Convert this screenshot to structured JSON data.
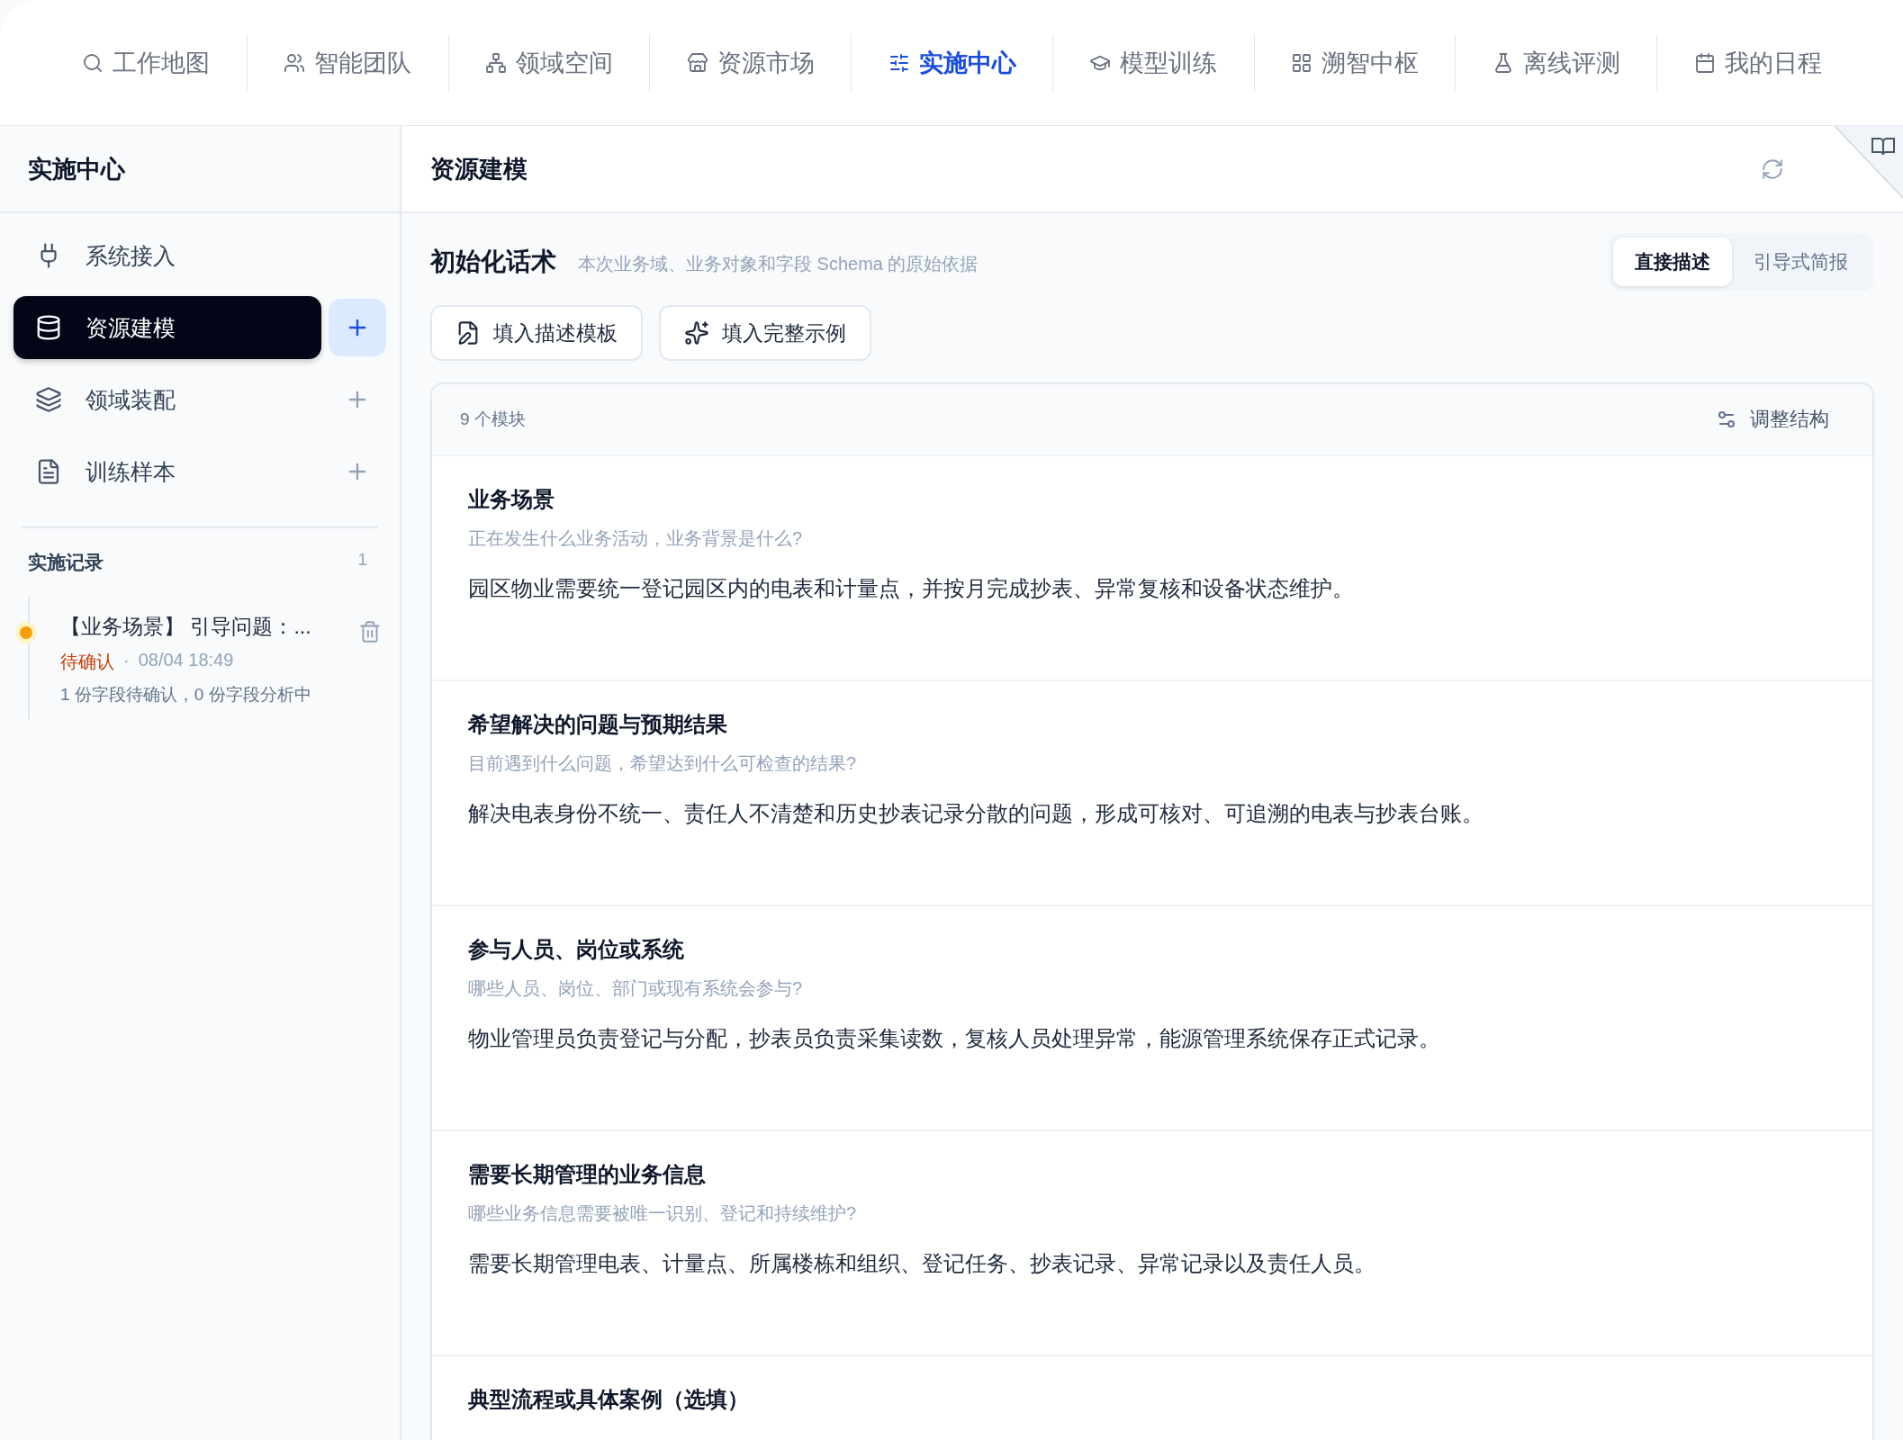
{
  "top_nav": [
    {
      "label": "工作地图",
      "selected": false
    },
    {
      "label": "智能团队",
      "selected": false
    },
    {
      "label": "领域空间",
      "selected": false
    },
    {
      "label": "资源市场",
      "selected": false
    },
    {
      "label": "实施中心",
      "selected": true
    },
    {
      "label": "模型训练",
      "selected": false
    },
    {
      "label": "溯智中枢",
      "selected": false
    },
    {
      "label": "离线评测",
      "selected": false
    },
    {
      "label": "我的日程",
      "selected": false
    }
  ],
  "sidebar": {
    "title": "实施中心",
    "items": [
      {
        "label": "系统接入",
        "selected": false,
        "addable": false
      },
      {
        "label": "资源建模",
        "selected": true,
        "addable": true
      },
      {
        "label": "领域装配",
        "selected": false,
        "addable": true
      },
      {
        "label": "训练样本",
        "selected": false,
        "addable": true
      }
    ],
    "records": {
      "title": "实施记录",
      "count": "1",
      "items": [
        {
          "title": "【业务场景】 引导问题：...",
          "status": "待确认",
          "separator": "·",
          "time": "08/04 18:49",
          "summary": "1 份字段待确认，0 份字段分析中",
          "color": "#f59e0b"
        }
      ]
    }
  },
  "page": {
    "title": "资源建模",
    "section": {
      "title": "初始化话术",
      "subtitle": "本次业务域、业务对象和字段 Schema 的原始依据",
      "modes": [
        {
          "label": "直接描述",
          "selected": true
        },
        {
          "label": "引导式简报",
          "selected": false
        }
      ],
      "actions": [
        "填入描述模板",
        "填入完整示例"
      ],
      "modules": {
        "count": "9 个模块",
        "adjust": "调整结构",
        "items": [
          {
            "title": "业务场景",
            "hint": "正在发生什么业务活动，业务背景是什么?",
            "value": "园区物业需要统一登记园区内的电表和计量点，并按月完成抄表、异常复核和设备状态维护。"
          },
          {
            "title": "希望解决的问题与预期结果",
            "hint": "目前遇到什么问题，希望达到什么可检查的结果?",
            "value": "解决电表身份不统一、责任人不清楚和历史抄表记录分散的问题，形成可核对、可追溯的电表与抄表台账。"
          },
          {
            "title": "参与人员、岗位或系统",
            "hint": "哪些人员、岗位、部门或现有系统会参与?",
            "value": "物业管理员负责登记与分配，抄表员负责采集读数，复核人员处理异常，能源管理系统保存正式记录。"
          },
          {
            "title": "需要长期管理的业务信息",
            "hint": "哪些业务信息需要被唯一识别、登记和持续维护?",
            "value": "需要长期管理电表、计量点、所属楼栋和组织、登记任务、抄表记录、异常记录以及责任人员。"
          },
          {
            "title": "典型流程或具体案例（选填）"
          }
        ]
      }
    }
  }
}
